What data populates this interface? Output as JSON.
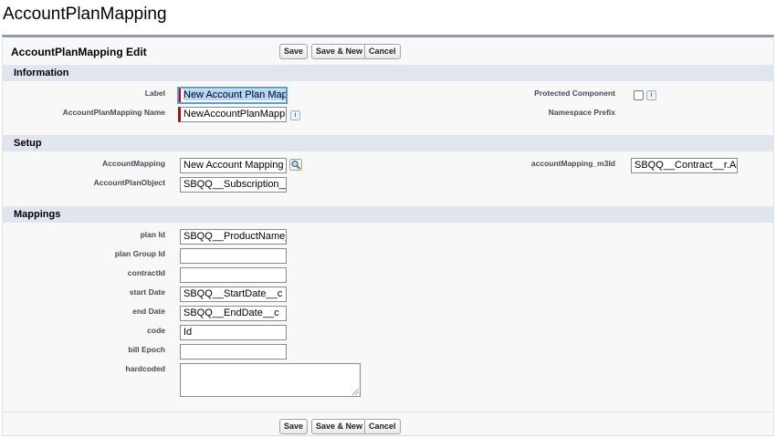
{
  "page": {
    "title": "AccountPlanMapping"
  },
  "panel": {
    "title": "AccountPlanMapping Edit"
  },
  "buttons": {
    "save": "Save",
    "save_new": "Save & New",
    "cancel": "Cancel"
  },
  "sections": {
    "information": {
      "title": "Information",
      "label_label": "Label",
      "label_value": "New Account Plan Mapping",
      "name_label": "AccountPlanMapping Name",
      "name_value": "NewAccountPlanMapping",
      "protected_label": "Protected Component",
      "protected_checked": false,
      "namespace_label": "Namespace Prefix"
    },
    "setup": {
      "title": "Setup",
      "account_mapping_label": "AccountMapping",
      "account_mapping_value": "New Account Mapping",
      "object_label": "AccountPlanObject",
      "object_value": "SBQQ__Subscription__c",
      "m3id_label": "accountMapping_m3Id",
      "m3id_value": "SBQQ__Contract__r.AccountId"
    },
    "mappings": {
      "title": "Mappings",
      "fields": [
        {
          "label": "plan Id",
          "value": "SBQQ__ProductName__c"
        },
        {
          "label": "plan Group Id",
          "value": ""
        },
        {
          "label": "contractId",
          "value": ""
        },
        {
          "label": "start Date",
          "value": "SBQQ__StartDate__c"
        },
        {
          "label": "end Date",
          "value": "SBQQ__EndDate__c"
        },
        {
          "label": "code",
          "value": "Id"
        },
        {
          "label": "bill Epoch",
          "value": ""
        }
      ],
      "hardcoded_label": "hardcoded",
      "hardcoded_value": ""
    }
  },
  "icons": {
    "info": "info-icon",
    "lookup": "lookup-magnifier-icon"
  },
  "colors": {
    "section_bg": "#e0e5ee",
    "required": "#cc0000",
    "panel_border": "#8e9aa4"
  }
}
